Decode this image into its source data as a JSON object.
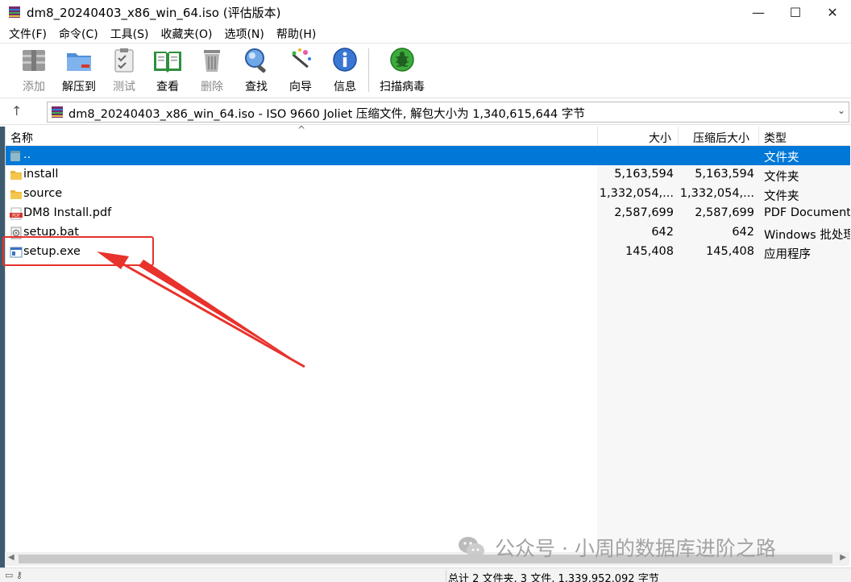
{
  "window": {
    "title": "dm8_20240403_x86_win_64.iso (评估版本)",
    "min": "—",
    "max": "☐",
    "close": "✕"
  },
  "menu": [
    "文件(F)",
    "命令(C)",
    "工具(S)",
    "收藏夹(O)",
    "选项(N)",
    "帮助(H)"
  ],
  "toolbar": {
    "add": "添加",
    "extract": "解压到",
    "test": "测试",
    "view": "查看",
    "delete": "删除",
    "find": "查找",
    "wizard": "向导",
    "info": "信息",
    "scan": "扫描病毒"
  },
  "address": {
    "text": "dm8_20240403_x86_win_64.iso - ISO 9660 Joliet 压缩文件, 解包大小为 1,340,615,644 字节",
    "up": "↑",
    "dropdown": "⌄"
  },
  "columns": {
    "name": "名称",
    "size": "大小",
    "packed": "压缩后大小",
    "type": "类型",
    "sort_caret": "^"
  },
  "files": [
    {
      "name": "..",
      "size": "",
      "packed": "",
      "type": "文件夹",
      "icon": "parent-folder-icon"
    },
    {
      "name": "install",
      "size": "5,163,594",
      "packed": "5,163,594",
      "type": "文件夹",
      "icon": "folder-icon"
    },
    {
      "name": "source",
      "size": "1,332,054,...",
      "packed": "1,332,054,...",
      "type": "文件夹",
      "icon": "folder-icon"
    },
    {
      "name": "DM8 Install.pdf",
      "size": "2,587,699",
      "packed": "2,587,699",
      "type": "PDF Document",
      "icon": "pdf-icon"
    },
    {
      "name": "setup.bat",
      "size": "642",
      "packed": "642",
      "type": "Windows 批处理",
      "icon": "bat-icon"
    },
    {
      "name": "setup.exe",
      "size": "145,408",
      "packed": "145,408",
      "type": "应用程序",
      "icon": "exe-icon"
    }
  ],
  "status": {
    "text": "总计 2 文件夹, 3 文件, 1,339,952,092 字节"
  },
  "watermark": {
    "text": "公众号 · 小周的数据库进阶之路"
  },
  "colors": {
    "selection": "#0078d7",
    "annotation": "#e8322b",
    "folder": "#f3c74d"
  }
}
